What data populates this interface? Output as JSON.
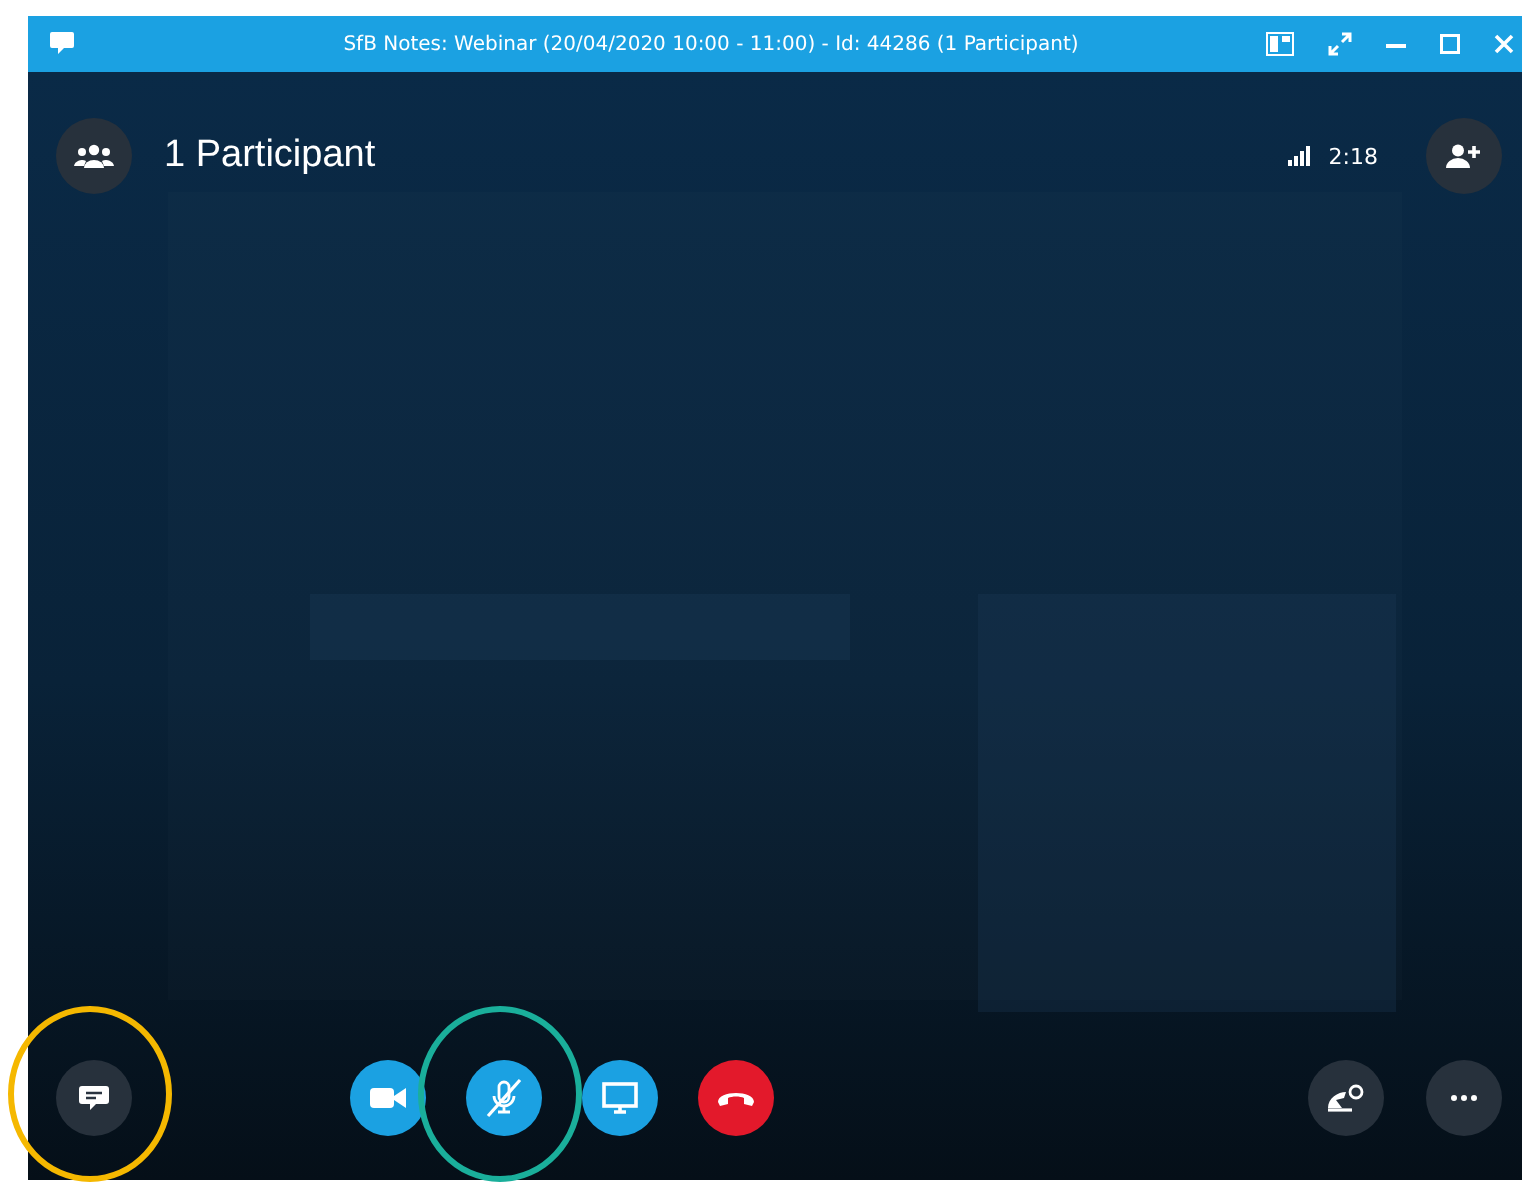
{
  "window": {
    "title": "SfB Notes: Webinar (20/04/2020 10:00 -  11:00) - Id: 44286 (1 Participant)"
  },
  "header": {
    "participants": "1 Participant",
    "call_time": "2:18"
  },
  "chat_button": {
    "highlight": {
      "color": "#f5b800"
    }
  },
  "controls": [
    {
      "kind": "video"
    },
    {
      "kind": "mic",
      "muted": true,
      "highlight": {
        "color": "#1aaf9b"
      }
    },
    {
      "kind": "share"
    },
    {
      "kind": "hangup"
    }
  ]
}
